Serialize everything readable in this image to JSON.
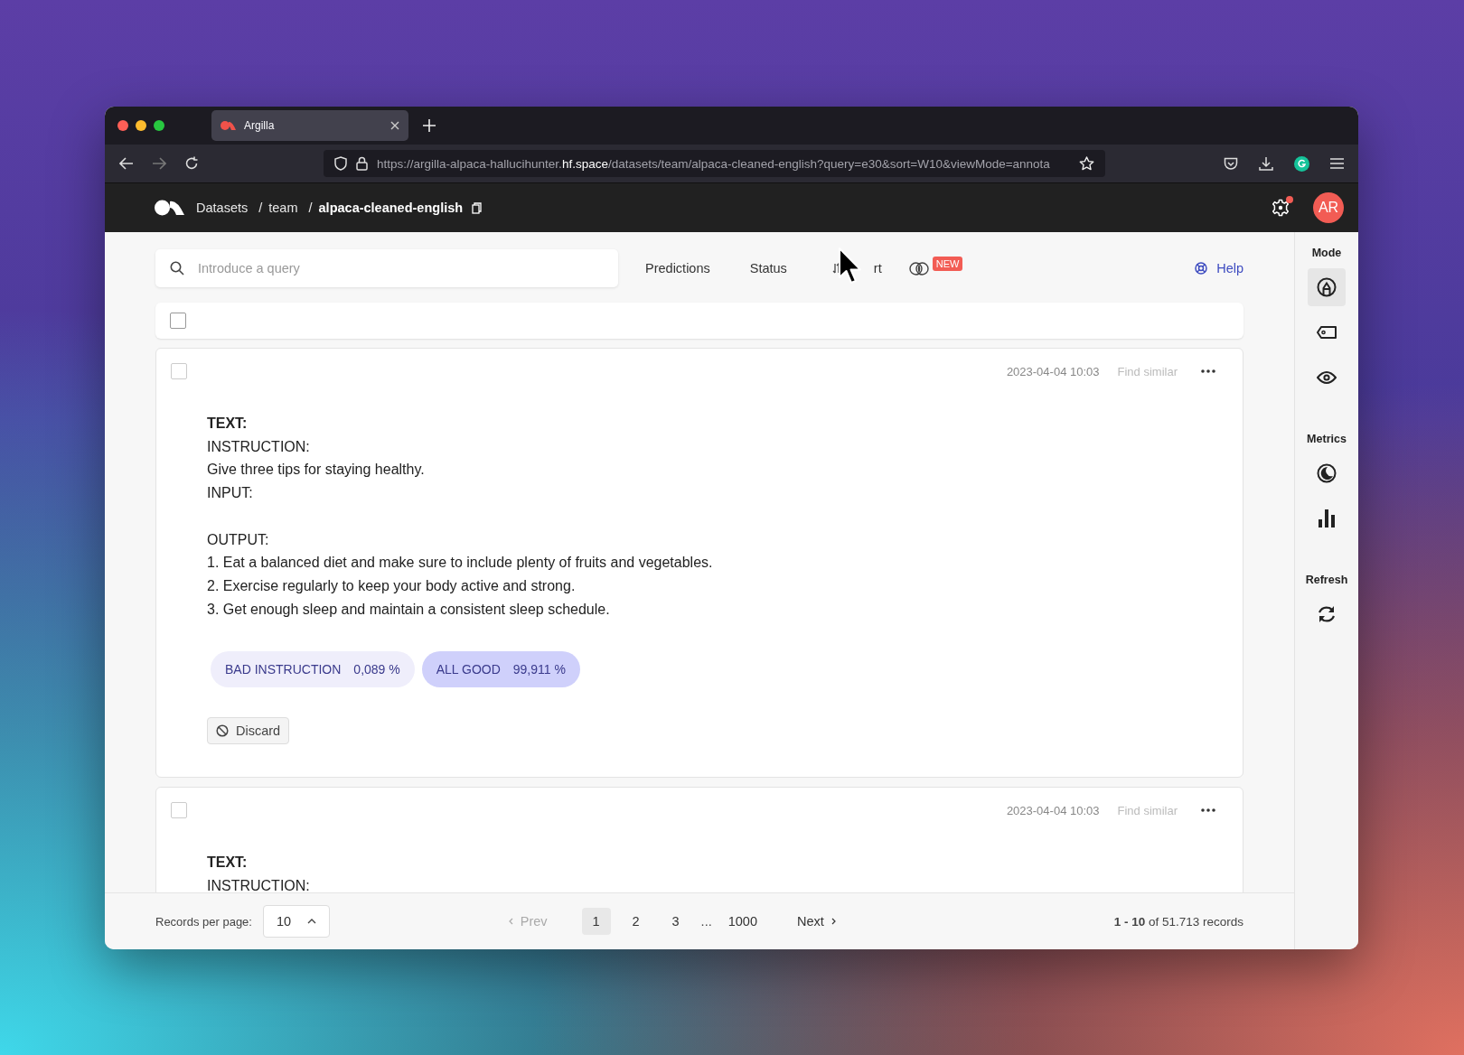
{
  "browser": {
    "tab_title": "Argilla",
    "url": "https://argilla-alpaca-hallucihunter.**hf.space**/datasets/team/alpaca-cleaned-english?query=e30&sort=W10&viewMode=annota"
  },
  "header": {
    "breadcrumbs": [
      "Datasets",
      "team",
      "alpaca-cleaned-english"
    ],
    "separator": "/",
    "settings_notification": true,
    "avatar": "AR"
  },
  "toolbar": {
    "search": {
      "placeholder": "Introduce a query"
    },
    "filters": [
      "Predictions",
      "Status"
    ],
    "sort_label": "rt",
    "new_badge": "NEW",
    "help": "Help"
  },
  "select_all": {
    "checked": false
  },
  "records": [
    {
      "checked": false,
      "date": "2023-04-04 10:03",
      "find_similar": "Find similar",
      "heading": "TEXT:",
      "paragraphs": [
        [
          "INSTRUCTION:",
          "Give three tips for staying healthy.",
          "INPUT:"
        ],
        [
          "OUTPUT:",
          "1. Eat a balanced diet and make sure to include plenty of fruits and vegetables.",
          "2. Exercise regularly to keep your body active and strong.",
          "3. Get enough sleep and maintain a consistent sleep schedule."
        ]
      ],
      "predictions": [
        {
          "label": "BAD INSTRUCTION",
          "score": "0,089 %",
          "selected": false
        },
        {
          "label": "ALL GOOD",
          "score": "99,911 %",
          "selected": true
        }
      ],
      "discard": "Discard"
    },
    {
      "checked": false,
      "date": "2023-04-04 10:03",
      "find_similar": "Find similar",
      "heading": "TEXT:",
      "paragraphs": [
        [
          "INSTRUCTION:"
        ]
      ]
    }
  ],
  "footer": {
    "per_page_label": "Records per page:",
    "per_page_value": "10",
    "prev": "Prev",
    "prev_disabled": true,
    "pages": [
      {
        "label": "1",
        "selected": true
      },
      {
        "label": "2",
        "selected": false
      },
      {
        "label": "3",
        "selected": false
      }
    ],
    "ellipsis": "...",
    "last_page": "1000",
    "next": "Next",
    "summary": "**1 - 10** of 51.713 records"
  },
  "sidebar": [
    {
      "title": "Mode",
      "items": [
        {
          "kind": "annotate",
          "selected": true
        },
        {
          "kind": "label",
          "selected": false
        },
        {
          "kind": "explore",
          "selected": false
        }
      ]
    },
    {
      "title": "Metrics",
      "items": [
        {
          "kind": "progress",
          "selected": false
        },
        {
          "kind": "stats",
          "selected": false
        }
      ]
    },
    {
      "title": "Refresh",
      "items": [
        {
          "kind": "refresh",
          "selected": false
        }
      ]
    }
  ]
}
